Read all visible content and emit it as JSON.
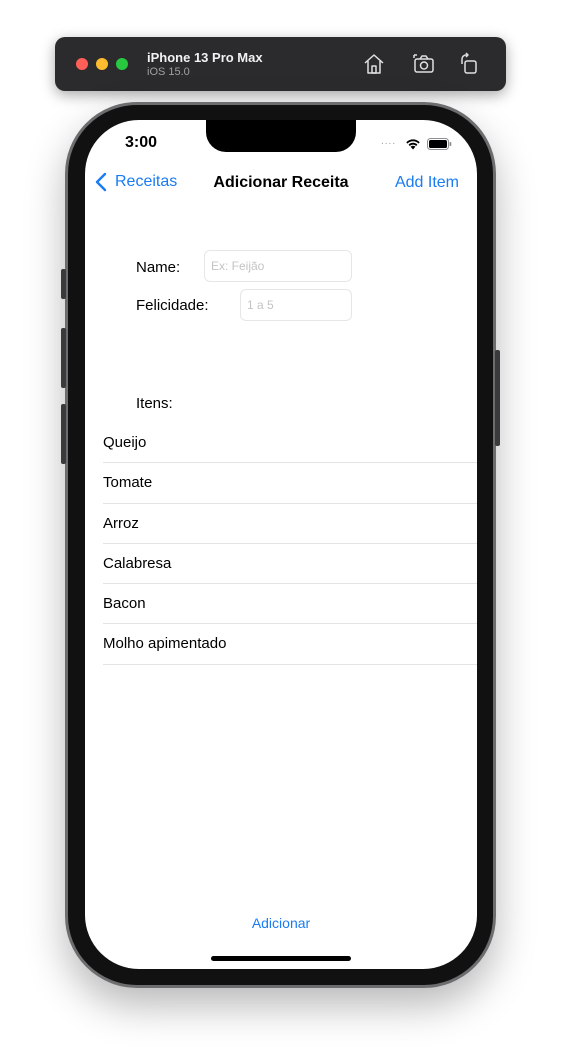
{
  "simulator": {
    "device_name": "iPhone 13 Pro Max",
    "os_version": "iOS 15.0",
    "icons": [
      "home-icon",
      "screenshot-icon",
      "rotate-icon"
    ]
  },
  "status_bar": {
    "time": "3:00",
    "signal": "....",
    "icons": [
      "wifi-icon",
      "battery-icon"
    ]
  },
  "nav": {
    "back_label": "Receitas",
    "title": "Adicionar Receita",
    "action_label": "Add Item"
  },
  "form": {
    "name_label": "Name:",
    "name_placeholder": "Ex: Feijão",
    "name_value": "",
    "happiness_label": "Felicidade:",
    "happiness_placeholder": "1 a 5",
    "happiness_value": ""
  },
  "items_section": {
    "label": "Itens:",
    "items": [
      "Queijo",
      "Tomate",
      "Arroz",
      "Calabresa",
      "Bacon",
      "Molho apimentado"
    ]
  },
  "footer": {
    "submit_label": "Adicionar"
  },
  "colors": {
    "accent": "#1a7cf2",
    "traffic_red": "#fe5f57",
    "traffic_yellow": "#febc2e",
    "traffic_green": "#28c840"
  }
}
